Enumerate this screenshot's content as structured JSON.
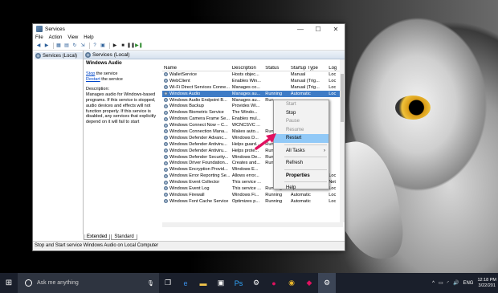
{
  "window": {
    "title": "Services",
    "min": "—",
    "max": "☐",
    "close": "✕"
  },
  "menu": [
    "File",
    "Action",
    "View",
    "Help"
  ],
  "tree": {
    "root": "Services (Local)"
  },
  "pane": {
    "header": "Services (Local)"
  },
  "desc": {
    "service_name": "Windows Audio",
    "stop_link": "Stop",
    "stop_suffix": " the service",
    "restart_link": "Restart",
    "restart_suffix": " the service",
    "label": "Description:",
    "text": "Manages audio for Windows-based programs.  If this service is stopped, audio devices and effects will not function properly.  If this service is disabled, any services that explicitly depend on it will fail to start"
  },
  "columns": [
    "Name",
    "Description",
    "Status",
    "Startup Type",
    "Log"
  ],
  "rows": [
    [
      "WalletService",
      "Hosts objec...",
      "",
      "Manual",
      "Loc"
    ],
    [
      "WebClient",
      "Enables Win...",
      "",
      "Manual (Trig...",
      "Loc"
    ],
    [
      "Wi-Fi Direct Services Conne...",
      "Manages co...",
      "",
      "Manual (Trig...",
      "Loc"
    ],
    [
      "Windows Audio",
      "Manages au...",
      "Running",
      "Automatic",
      "Loc"
    ],
    [
      "Windows Audio Endpoint B...",
      "Manages au...",
      "Run",
      "",
      ""
    ],
    [
      "Windows Backup",
      "Provides Wi...",
      "",
      "",
      ""
    ],
    [
      "Windows Biometric Service",
      "The Windo...",
      "",
      "",
      ""
    ],
    [
      "Windows Camera Frame Se...",
      "Enables mul...",
      "",
      "",
      ""
    ],
    [
      "Windows Connect Now – C...",
      "WCNCSVC ...",
      "",
      "",
      ""
    ],
    [
      "Windows Connection Mana...",
      "Makes auto...",
      "Run",
      "",
      ""
    ],
    [
      "Windows Defender Advanc...",
      "Windows D...",
      "",
      "",
      ""
    ],
    [
      "Windows Defender Antiviru...",
      "Helps guard...",
      "Run",
      "",
      ""
    ],
    [
      "Windows Defender Antiviru...",
      "Helps prote...",
      "Run",
      "",
      ""
    ],
    [
      "Windows Defender Security...",
      "Windows De...",
      "Run",
      "",
      ""
    ],
    [
      "Windows Driver Foundation...",
      "Creates and...",
      "Run",
      "",
      ""
    ],
    [
      "Windows Encryption Provid...",
      "Windows E...",
      "",
      "",
      ""
    ],
    [
      "Windows Error Reporting Se...",
      "Allows error...",
      "",
      "Manual (Trig...",
      "Loc"
    ],
    [
      "Windows Event Collector",
      "This service ...",
      "",
      "Manual",
      "Net"
    ],
    [
      "Windows Event Log",
      "This service ...",
      "Running",
      "Automatic",
      "Loc"
    ],
    [
      "Windows Firewall",
      "Windows Fi...",
      "Running",
      "Automatic",
      "Loc"
    ],
    [
      "Windows Font Cache Service",
      "Optimizes p...",
      "Running",
      "Automatic",
      "Loc"
    ]
  ],
  "tabs": [
    "Extended",
    "Standard"
  ],
  "status": "Stop and Start service Windows Audio on Local Computer",
  "context_menu": {
    "start": "Start",
    "stop": "Stop",
    "pause": "Pause",
    "resume": "Resume",
    "restart": "Restart",
    "all_tasks": "All Tasks",
    "refresh": "Refresh",
    "properties": "Properties",
    "help": "Help"
  },
  "taskbar": {
    "search_placeholder": "Ask me anything",
    "lang": "ENG",
    "time": "12:18 PM",
    "date": "3/22/201"
  }
}
